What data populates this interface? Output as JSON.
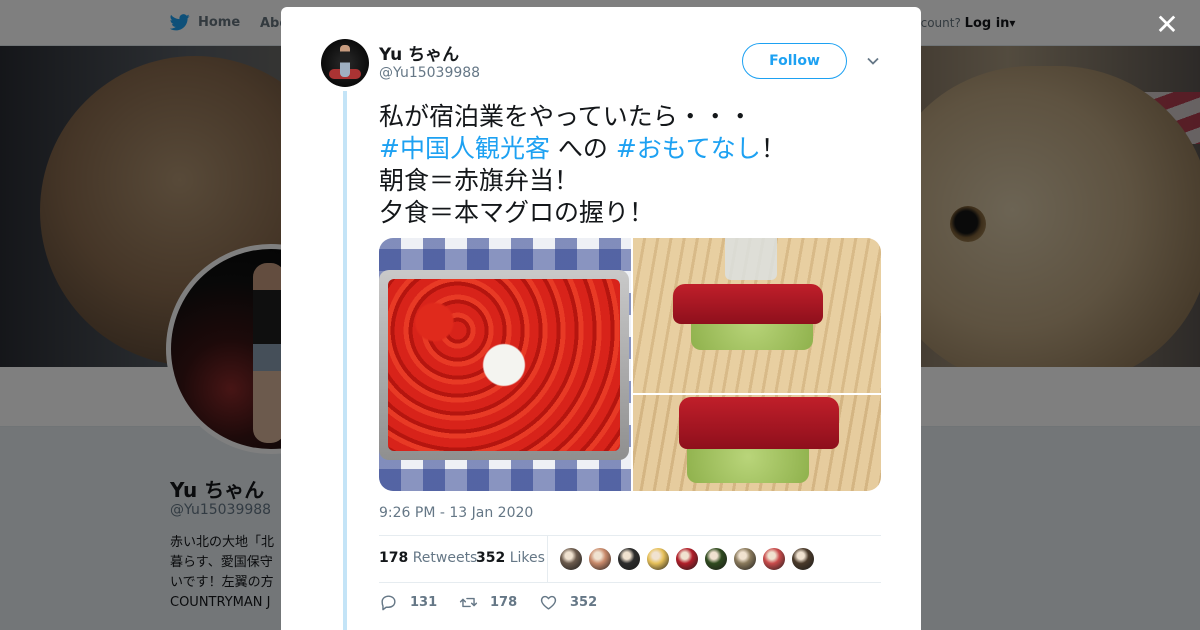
{
  "nav": {
    "home_label": "Home",
    "about_label": "Abo",
    "account_prompt": "ccount?",
    "login_label": "Log in"
  },
  "profile": {
    "name": "Yu ちゃん",
    "handle": "@Yu15039988",
    "bio_lines": [
      "赤い北の大地「北",
      "暮らす、愛国保守",
      "いです！左翼の方",
      "COUNTRYMAN J"
    ]
  },
  "tweet": {
    "author_name": "Yu ちゃん",
    "author_handle": "@Yu15039988",
    "follow_label": "Follow",
    "text": {
      "line1": "私が宿泊業をやっていたら・・・",
      "hashtag1": "#中国人観光客",
      "mid": " への ",
      "hashtag2": "#おもてなし",
      "end": "！",
      "line3": "朝食＝赤旗弁当！",
      "line4": "夕食＝本マグロの握り！"
    },
    "timestamp": "9:26 PM - 13 Jan 2020",
    "retweets_count": "178",
    "retweets_label": "Retweets",
    "likes_count": "352",
    "likes_label": "Likes",
    "reply_count": "131",
    "retweet_action_count": "178",
    "like_action_count": "352"
  },
  "colors": {
    "accent": "#1da1f2",
    "thread_line": "#c4e4f7"
  },
  "likers": [
    "#6b5a4c",
    "#c98a6b",
    "#2c2c2c",
    "#e7c15a",
    "#b11f2a",
    "#2f4b1f",
    "#8a7a5c",
    "#c94b4b",
    "#4a3a2a"
  ]
}
